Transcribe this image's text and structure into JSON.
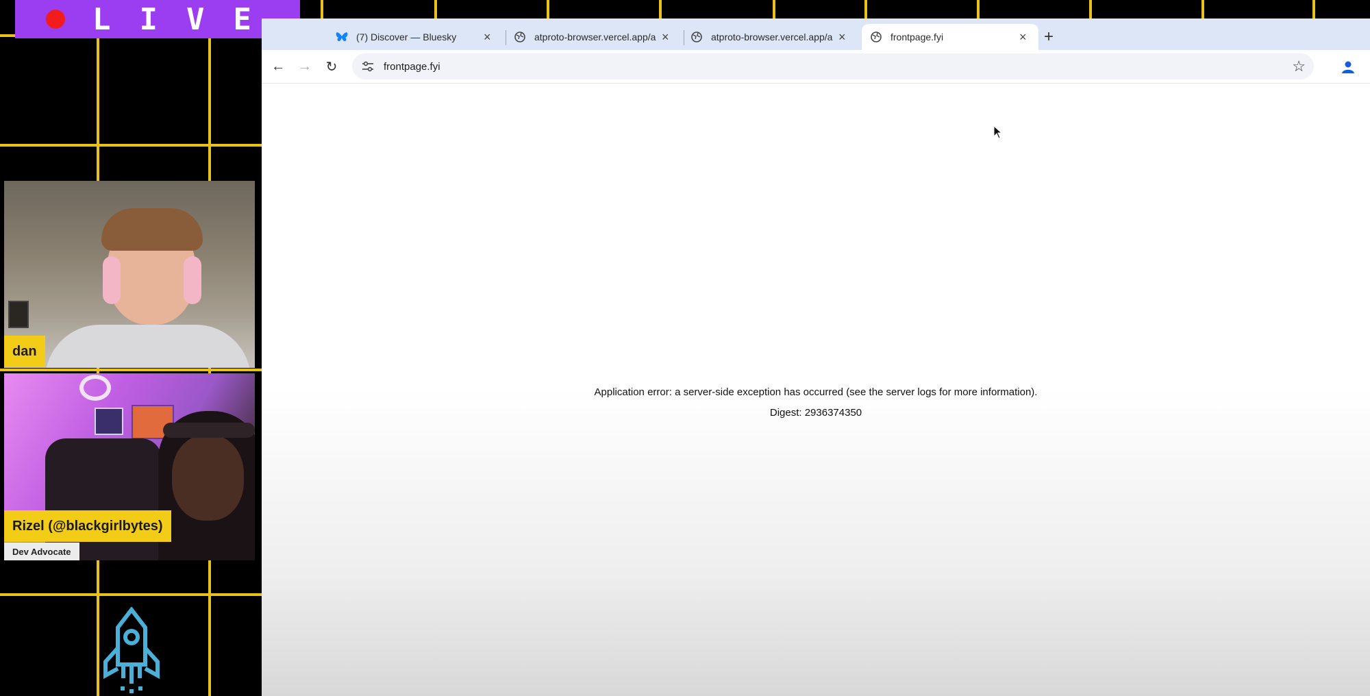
{
  "overlay": {
    "live_label": "LIVE",
    "colors": {
      "grid": "#e8c21a",
      "banner": "#9b3df0",
      "dot": "#f21c1c",
      "tag": "#f2cc17"
    }
  },
  "participants": [
    {
      "name": "dan"
    },
    {
      "name": "Rizel (@blackgirlbytes)",
      "role": "Dev Advocate"
    }
  ],
  "browser": {
    "tabs": [
      {
        "label": "(7) Discover — Bluesky",
        "icon": "bluesky-butterfly-icon"
      },
      {
        "label": "atproto-browser.vercel.app/a",
        "icon": "globe-icon"
      },
      {
        "label": "atproto-browser.vercel.app/a",
        "icon": "globe-icon"
      },
      {
        "label": "frontpage.fyi",
        "icon": "globe-icon",
        "active": true
      }
    ],
    "address": "frontpage.fyi"
  },
  "page": {
    "error_message": "Application error: a server-side exception has occurred (see the server logs for more information).",
    "digest": "Digest: 2936374350"
  }
}
